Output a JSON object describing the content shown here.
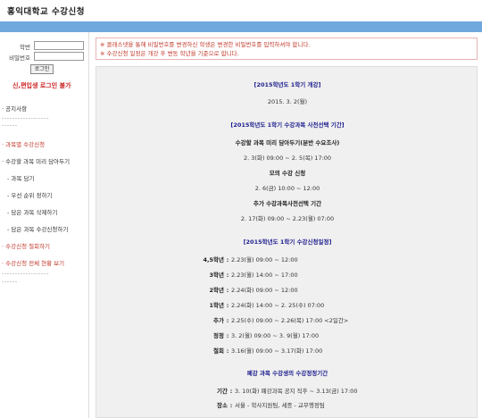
{
  "app": {
    "title": "홍익대학교 수강신청"
  },
  "login": {
    "id_label": "학번",
    "pw_label": "비밀번호",
    "button_label": "로그인",
    "transfer_link": "신,편입생 로그인 불가"
  },
  "menu": {
    "notice": "· 공지사항",
    "sep1": "------------------",
    "sep1b": "------",
    "by_class": "· 과목별 수강신청",
    "cart_group": "· 수강할 과목 미리 담아두기",
    "cart_add": "- 과목 담기",
    "cart_priority": "- 우선 순위 정하기",
    "cart_delete": "- 담은 과목 삭제하기",
    "cart_apply": "- 담은 과목 수강신청하기",
    "withdraw": "· 수강신청 철회하기",
    "full_status": "· 수강신청 전체 현황 보기",
    "sep2": "------------------",
    "sep2b": "------"
  },
  "notice": {
    "line1": "※ 클래스넷을 통해 비밀번호를 변경하신 학생은 변경한 비밀번호를 입력하셔야 합니다.",
    "line2": "※ 수강신청 일정은 개강 후 변동 학년을 기준으로 합니다."
  },
  "panel": {
    "open_title": "[2015학년도 1학기 개강]",
    "open_date": "2015. 3. 2(월)",
    "pre_title": "[2015학년도 1학기 수강과목 사전선택 기간]",
    "cart_heading": "수강할 과목 미리 담아두기(분반 수요조사)",
    "cart_date": "2. 3(화) 09:00 ~ 2. 5(목) 17:00",
    "mock_heading": "모의 수강 신청",
    "mock_date": "2. 6(금) 10:00 ~ 12:00",
    "extra_heading": "추가 수강과목사전선택 기간",
    "extra_date": "2. 17(화) 09:00 ~ 2.23(월) 07:00",
    "reg_title": "[2015학년도 1학기 수강신청일정]",
    "schedule": [
      {
        "label": "4,5학년",
        "value": "2.23(월) 09:00 ~ 12:00"
      },
      {
        "label": "3학년",
        "value": "2.23(월) 14:00 ~ 17:00"
      },
      {
        "label": "2학년",
        "value": "2.24(화) 09:00 ~ 12:00"
      },
      {
        "label": "1학년",
        "value": "2.24(화) 14:00 ~ 2. 25(수) 07:00"
      },
      {
        "label": "추가",
        "value": "2.25(수) 09:00 ~ 2.26(목) 17:00 <2일간>"
      },
      {
        "label": "정정",
        "value": "3. 2(월) 09:00 ~ 3. 9(월) 17:00"
      },
      {
        "label": "철회",
        "value": "3.16(월) 09:00 ~ 3.17(화) 17:00"
      }
    ],
    "cancel_title": "폐강 과목 수강생의 수강정정기간",
    "period_label": "기간",
    "period_value": "3. 10(화) 폐강과목 공지 직후 ~ 3.13(금) 17:00",
    "place_label": "장소",
    "place_value": "서울 - 학사지원팀, 세종 - 교무행정팀"
  },
  "colors": {
    "topbar": "#6fa8dc",
    "notice_text": "#c0392b",
    "heading_blue": "#1f1f8f",
    "panel_bg": "#f0f0f0"
  }
}
